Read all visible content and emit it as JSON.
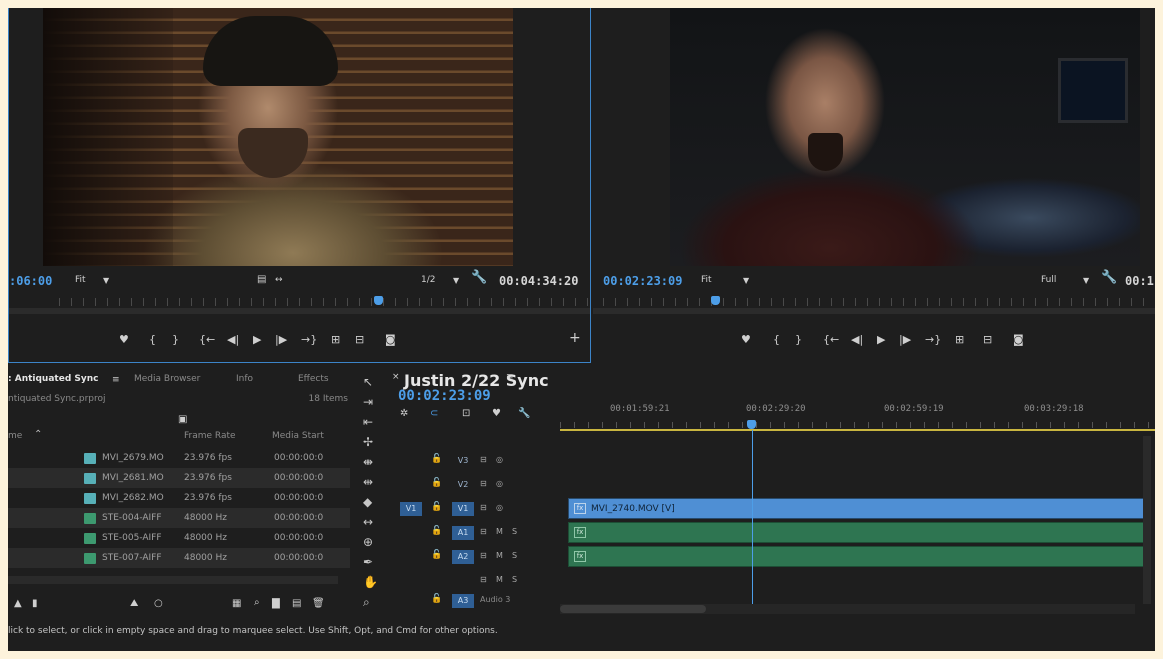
{
  "source_monitor": {
    "timecode": ":06:00",
    "zoom": "Fit",
    "resolution": "1/2",
    "duration": "00:04:34:20"
  },
  "program_monitor": {
    "timecode": "00:02:23:09",
    "zoom": "Fit",
    "resolution": "Full",
    "duration": "00:1"
  },
  "project_panel": {
    "tabs": [
      ": Antiquated Sync",
      "Media Browser",
      "Info",
      "Effects"
    ],
    "project_file": "ntiquated Sync.prproj",
    "item_count": "18 Items",
    "columns": [
      "me",
      "Frame Rate",
      "Media Start"
    ],
    "rows": [
      {
        "name": "MVI_2679.MO",
        "type": "video",
        "frame_rate": "23.976 fps",
        "media_start": "00:00:00:0"
      },
      {
        "name": "MVI_2681.MO",
        "type": "video",
        "frame_rate": "23.976 fps",
        "media_start": "00:00:00:0"
      },
      {
        "name": "MVI_2682.MO",
        "type": "video",
        "frame_rate": "23.976 fps",
        "media_start": "00:00:00:0"
      },
      {
        "name": "STE-004-AIFF",
        "type": "audio",
        "frame_rate": "48000 Hz",
        "media_start": "00:00:00:0"
      },
      {
        "name": "STE-005-AIFF",
        "type": "audio",
        "frame_rate": "48000 Hz",
        "media_start": "00:00:00:0"
      },
      {
        "name": "STE-007-AIFF",
        "type": "audio",
        "frame_rate": "48000 Hz",
        "media_start": "00:00:00:0"
      }
    ]
  },
  "timeline": {
    "sequence_tab": "Justin 2/22 Sync",
    "timecode": "00:02:23:09",
    "ruler_labels": [
      "00:01:59:21",
      "00:02:29:20",
      "00:02:59:19",
      "00:03:29:18"
    ],
    "tracks": {
      "v3": "V3",
      "v2": "V2",
      "v1_src": "V1",
      "v1": "V1",
      "a1": "A1",
      "a2": "A2",
      "a3": "A3",
      "audio3_name": "Audio 3",
      "mute": "M",
      "solo": "S"
    },
    "video_clip_name": "MVI_2740.MOV [V]",
    "fx_badge": "fx"
  },
  "status_bar": {
    "text": "lick to select, or click in empty space and drag to marquee select. Use Shift, Opt, and Cmd for other options."
  },
  "colors": {
    "accent": "#4d9ee8",
    "video_clip": "#4f8fd4",
    "audio_clip": "#2e7551",
    "panel_bg": "#1e1e1e",
    "page_bg": "#fdf3dc"
  }
}
